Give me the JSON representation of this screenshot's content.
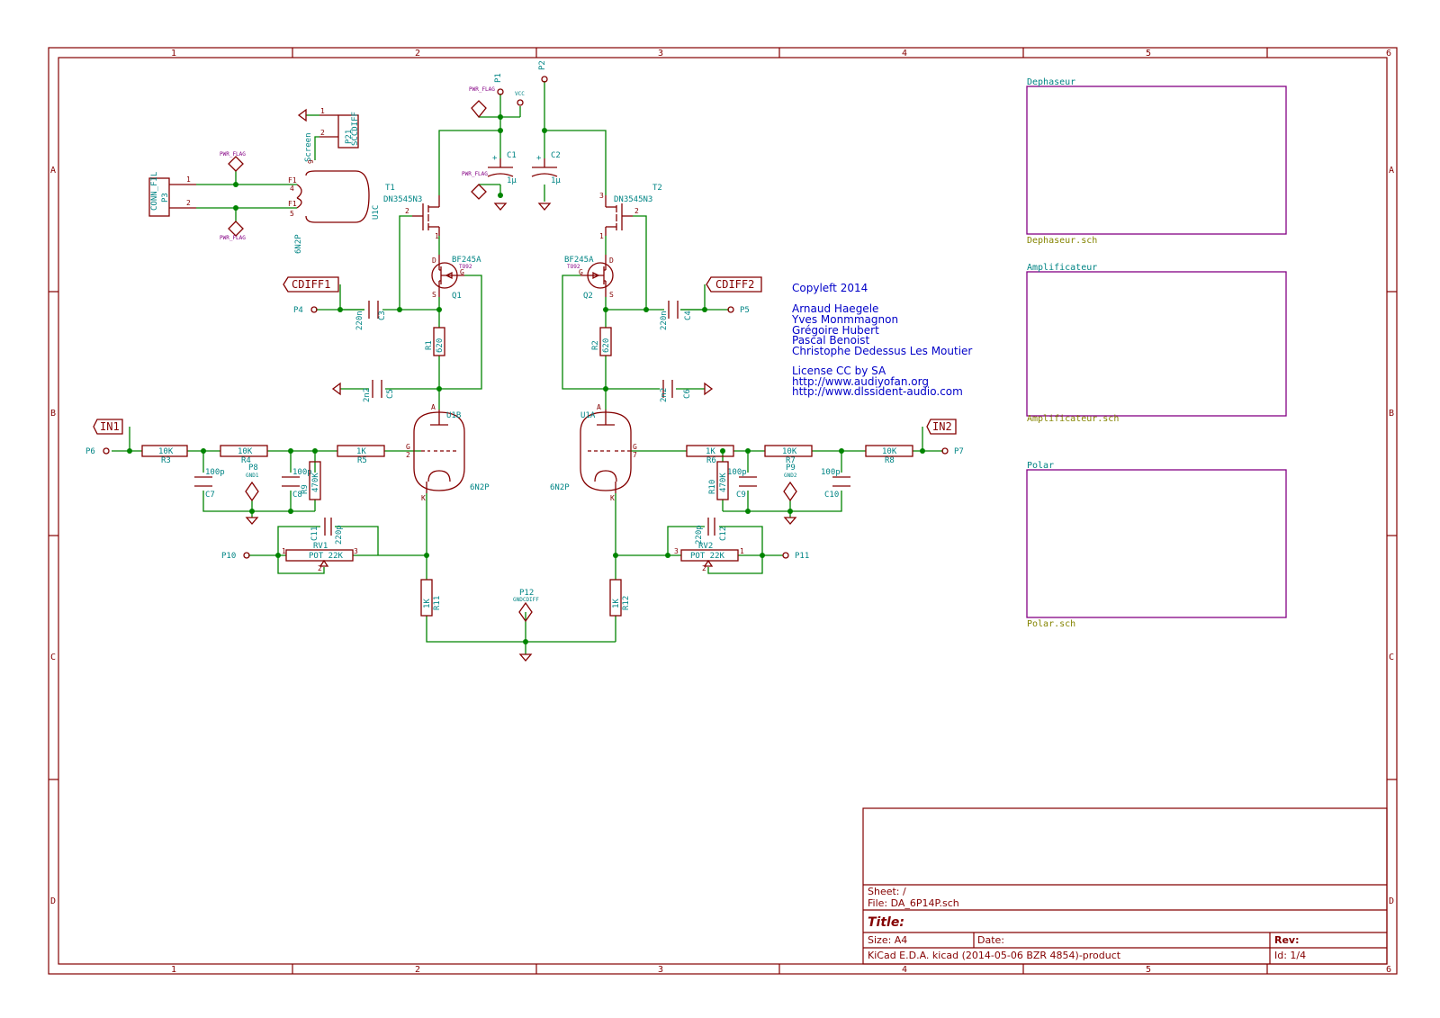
{
  "frame": {
    "columns_top": [
      "1",
      "2",
      "3",
      "4",
      "5",
      "6"
    ],
    "rows_side": [
      "A",
      "B",
      "C",
      "D"
    ]
  },
  "notes": {
    "copyleft": "Copyleft 2014",
    "authors": [
      "Arnaud Haegele",
      "Yves Monmmagnon",
      "Grégoire Hubert",
      "Pascal Benoist",
      "Christophe Dedessus Les Moutier"
    ],
    "license": "License CC by SA",
    "urls": [
      "http://www.audiyofan.org",
      "http://www.dlssident-audio.com"
    ]
  },
  "hier_sheets": [
    {
      "name": "Dephaseur",
      "file": "Dephaseur.sch"
    },
    {
      "name": "Amplificateur",
      "file": "Amplificateur.sch"
    },
    {
      "name": "Polar",
      "file": "Polar.sch"
    }
  ],
  "title_block": {
    "sheet": "Sheet: /",
    "file": "File: DA_6P14P.sch",
    "title": "Title:",
    "size": "Size: A4",
    "date": "Date:",
    "rev": "Rev:",
    "tool": "KiCad E.D.A.  kicad (2014-05-06 BZR 4854)-product",
    "id": "Id: 1/4"
  },
  "labels": {
    "cdiff1": "CDIFF1",
    "cdiff2": "CDIFF2",
    "in1": "IN1",
    "in2": "IN2"
  },
  "components": {
    "p1": "P1",
    "p2": "P2",
    "vcc": "VCC",
    "pwr_flag": "PWR_FLAG",
    "c1": "C1",
    "c2": "C2",
    "c1v": "1µ",
    "c2v": "1µ",
    "p21": "P21",
    "p21v": "SCCDIFF",
    "p3": "P3",
    "p3v": "CONN_FIL",
    "u1c": "U1C",
    "screen": "Screen",
    "6n2p": "6N2P",
    "t1": "T1",
    "t2": "T2",
    "dn": "DN3545N3",
    "bf": "BF245A",
    "to92": "TO92",
    "q1": "Q1",
    "q2": "Q2",
    "c3": "C3",
    "c4": "C4",
    "c220n": "220n",
    "p4": "P4",
    "p5": "P5",
    "r1": "R1",
    "r2": "R2",
    "r620": "620",
    "c5": "C5",
    "c6": "C6",
    "c2n2": "2n2",
    "u1b": "U1B",
    "u1a": "U1A",
    "p6": "P6",
    "p7": "P7",
    "r3": "R3",
    "r4": "R4",
    "r5": "R5",
    "r6": "R6",
    "r7": "R7",
    "r8": "R8",
    "r10k": "10K",
    "r1k": "1K",
    "c7": "C7",
    "c8": "C8",
    "c9": "C9",
    "c10": "C10",
    "c100p": "100p",
    "p8": "P8",
    "gnd1": "GND1",
    "p9": "P9",
    "gnd2": "GND2",
    "r9": "R9",
    "r10": "R10",
    "r470k": "470K",
    "c11": "C11",
    "c12": "C12",
    "c220p": "220p",
    "rv1": "RV1",
    "rv2": "RV2",
    "pot": "POT 22K",
    "p10": "P10",
    "p11": "P11",
    "r11": "R11",
    "r12": "R12",
    "p12": "P12",
    "gndcdiff": "GNDCDIFF"
  }
}
